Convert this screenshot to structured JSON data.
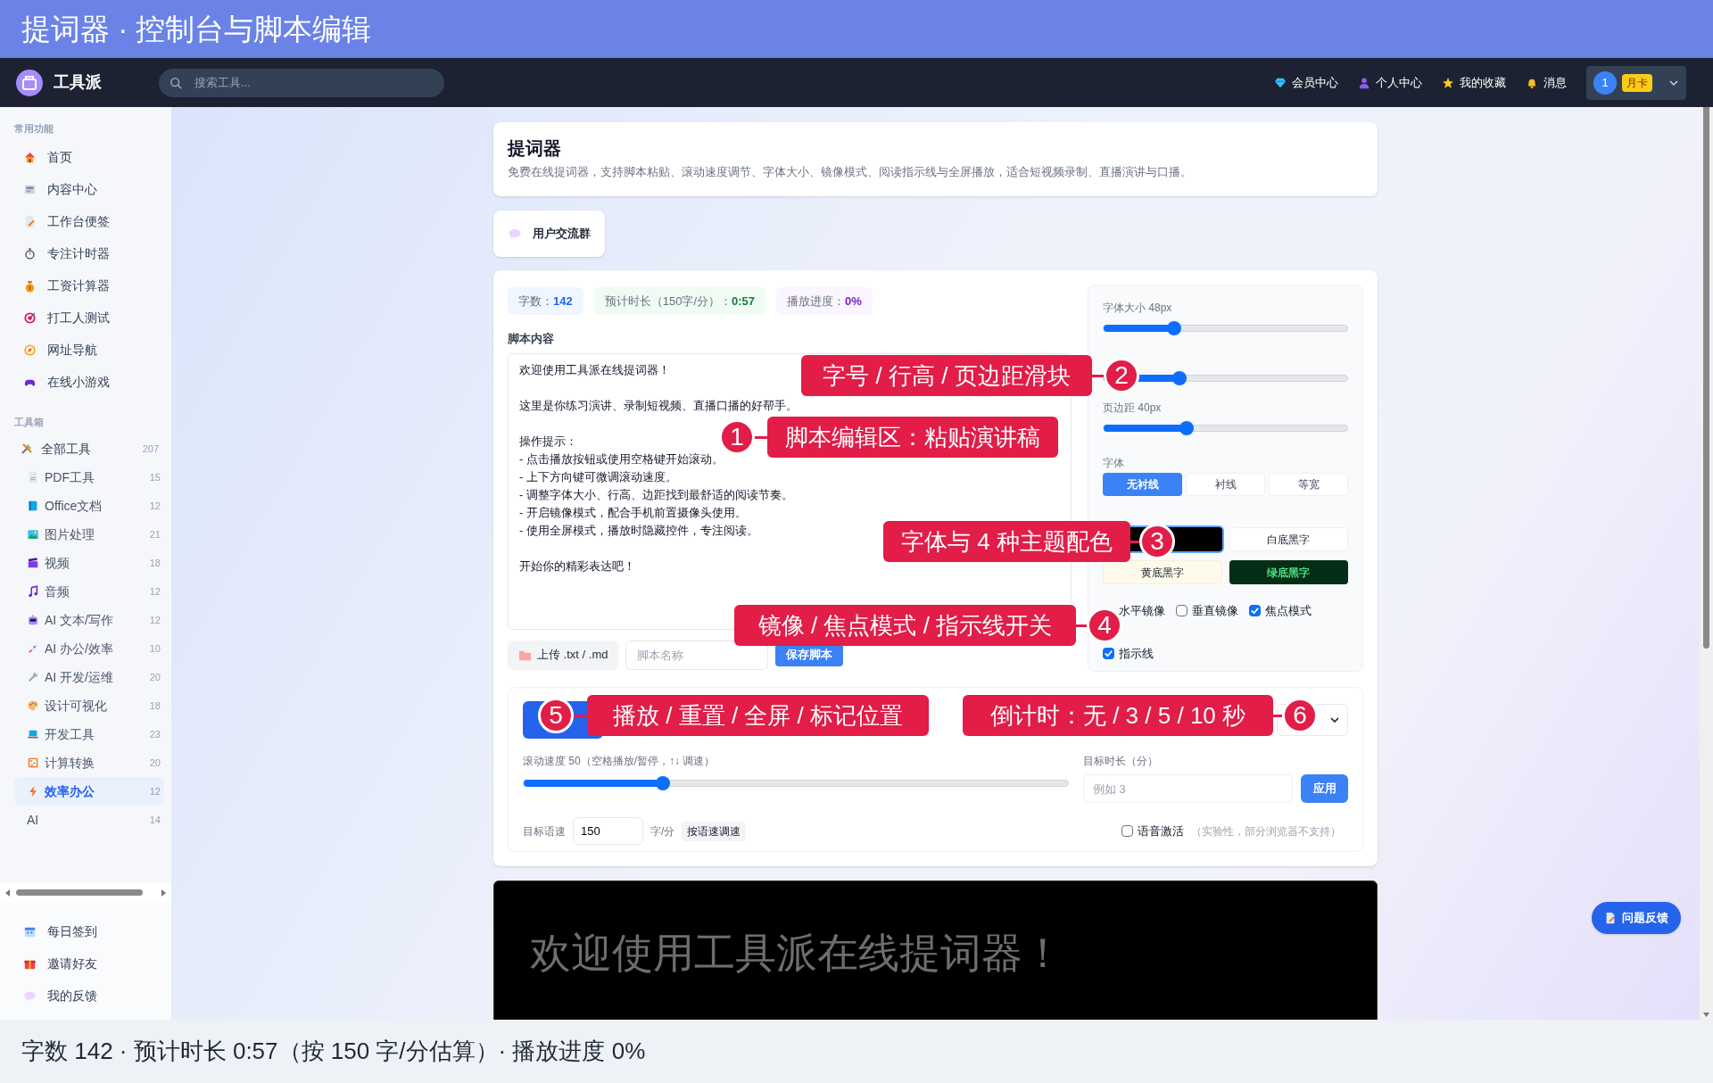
{
  "window": {
    "title": "提词器 · 控制台与脚本编辑"
  },
  "navbar": {
    "brand": "工具派",
    "search": {
      "placeholder": "搜索工具..."
    },
    "links": [
      "会员中心",
      "个人中心",
      "我的收藏",
      "消息"
    ],
    "user": {
      "avatar": "1",
      "badge": "月卡"
    }
  },
  "sidebar": {
    "sections": [
      {
        "title": "常用功能",
        "items": [
          {
            "label": "首页",
            "selected": false
          },
          {
            "label": "内容中心",
            "selected": false
          },
          {
            "label": "工作台便签",
            "selected": false
          },
          {
            "label": "专注计时器",
            "selected": false
          },
          {
            "label": "工资计算器",
            "selected": false
          },
          {
            "label": "打工人测试",
            "selected": false
          },
          {
            "label": "网址导航",
            "selected": false
          },
          {
            "label": "在线小游戏",
            "selected": false
          }
        ]
      },
      {
        "title": "工具箱",
        "items": [
          {
            "label": "全部工具",
            "count": "207",
            "selected": false,
            "children": [
              {
                "label": "PDF工具",
                "count": "15",
                "selected": false
              },
              {
                "label": "Office文档",
                "count": "12",
                "selected": false
              },
              {
                "label": "图片处理",
                "count": "21",
                "selected": false
              },
              {
                "label": "视频",
                "count": "18",
                "selected": false
              },
              {
                "label": "音频",
                "count": "12",
                "selected": false
              },
              {
                "label": "AI 文本/写作",
                "count": "12",
                "selected": false
              },
              {
                "label": "AI 办公/效率",
                "count": "10",
                "selected": false
              },
              {
                "label": "AI 开发/运维",
                "count": "20",
                "selected": false
              },
              {
                "label": "设计可视化",
                "count": "18",
                "selected": false
              },
              {
                "label": "开发工具",
                "count": "23",
                "selected": false
              },
              {
                "label": "计算转换",
                "count": "20",
                "selected": false
              },
              {
                "label": "效率办公",
                "count": "12",
                "selected": true
              },
              {
                "label": "AI",
                "count": "14",
                "selected": false
              }
            ]
          }
        ]
      }
    ],
    "footer_items": [
      {
        "label": "每日签到"
      },
      {
        "label": "邀请好友"
      },
      {
        "label": "我的反馈"
      }
    ]
  },
  "intro": {
    "title": "提词器",
    "description": "免费在线提词器，支持脚本粘贴、滚动速度调节、字体大小、镜像模式、阅读指示线与全屏播放，适合短视频录制、直播演讲与口播。"
  },
  "community_button": "用户交流群",
  "stats": [
    {
      "label": "字数：",
      "value": "142",
      "color": "#2563eb"
    },
    {
      "label": "预计时长（150字/分）：",
      "value": "0:57",
      "color": "#15803d"
    },
    {
      "label": "播放进度：",
      "value": "0%",
      "color": "#7e22ce"
    }
  ],
  "editor": {
    "label": "脚本内容",
    "paragraphs": [
      [
        "欢迎使用工具派在线提词器！"
      ],
      [
        "这里是你练习演讲、录制短视频、直播口播的好帮手。"
      ],
      [
        "操作提示：",
        "- 点击播放按钮或使用空格键开始滚动。",
        "- 上下方向键可微调滚动速度。",
        "- 调整字体大小、行高、边距找到最舒适的阅读节奏。",
        "- 开启镜像模式，配合手机前置摄像头使用。",
        "- 使用全屏模式，播放时隐藏控件，专注阅读。"
      ],
      [
        "开始你的精彩表达吧！"
      ]
    ],
    "upload_button": "上传 .txt / .md",
    "name_field": {
      "placeholder": "脚本名称"
    },
    "save_button": "保存脚本"
  },
  "settings": {
    "sliders": [
      {
        "label": "字体大小 48px",
        "level": 0.29
      },
      {
        "level": 0.31
      },
      {
        "label": "页边距 40px",
        "level": 0.34
      }
    ],
    "font": {
      "label": "字体",
      "options": [
        {
          "label": "无衬线",
          "selected": true
        },
        {
          "label": "衬线",
          "selected": false
        },
        {
          "label": "等宽",
          "selected": false
        }
      ]
    },
    "themes": [
      {
        "kind": "black",
        "selected": true
      },
      {
        "label": "白底黑字",
        "kind": "white",
        "selected": false
      },
      {
        "label": "黄底黑字",
        "kind": "yellow",
        "selected": false
      },
      {
        "label": "绿底黑字",
        "kind": "green",
        "selected": false
      }
    ],
    "toggles": [
      {
        "label": "水平镜像"
      },
      {
        "label": "垂直镜像",
        "checked": false
      },
      {
        "label": "焦点模式",
        "checked": true
      },
      {
        "label": "指示线",
        "checked": true
      }
    ]
  },
  "speed": {
    "label": "滚动速度 50（空格播放/暂停，↑↓ 调速）",
    "level": 0.256
  },
  "target_duration": {
    "label": "目标时长（分）",
    "placeholder": "例如 3",
    "button": "应用"
  },
  "target_rate": {
    "label": "目标语速",
    "value": "150",
    "unit": "字/分",
    "button": "按语速调速"
  },
  "voice": {
    "label": "语音激活",
    "checked": false,
    "hint": "（实验性，部分浏览器不支持）"
  },
  "preview": {
    "text": "欢迎使用工具派在线提词器！"
  },
  "feedback_button": "问题反馈",
  "status_bar": "字数 142 · 预计时长 0:57（按 150 字/分估算）· 播放进度 0%",
  "callouts": [
    {
      "number": "2",
      "text": "字号 / 行高 / 页边距滑块"
    },
    {
      "number": "1",
      "text": "脚本编辑区：粘贴演讲稿"
    },
    {
      "number": "3",
      "text": "字体与 4 种主题配色"
    },
    {
      "number": "4",
      "text": "镜像 / 焦点模式 / 指示线开关"
    },
    {
      "number": "5",
      "text": "播放 / 重置 / 全屏 / 标记位置"
    },
    {
      "number": "6",
      "text": "倒计时：无 / 3 / 5 / 10 秒"
    }
  ]
}
